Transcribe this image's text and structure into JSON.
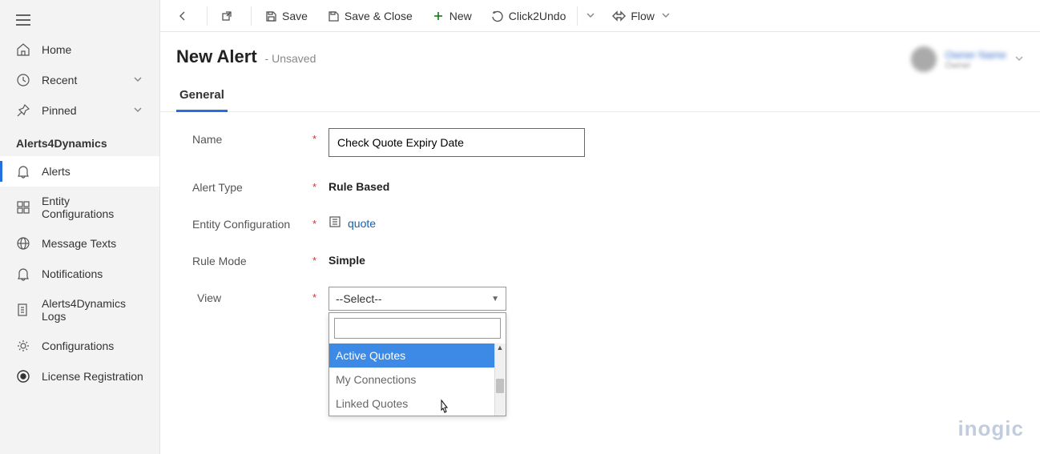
{
  "sidebar": {
    "section_title": "Alerts4Dynamics",
    "top_items": [
      {
        "label": "Home",
        "icon": "home"
      },
      {
        "label": "Recent",
        "icon": "clock",
        "chevron": true
      },
      {
        "label": "Pinned",
        "icon": "pin",
        "chevron": true
      }
    ],
    "items": [
      {
        "label": "Alerts",
        "icon": "bell",
        "active": true
      },
      {
        "label": "Entity Configurations",
        "icon": "grid"
      },
      {
        "label": "Message Texts",
        "icon": "globe"
      },
      {
        "label": "Notifications",
        "icon": "bell2"
      },
      {
        "label": "Alerts4Dynamics Logs",
        "icon": "log"
      },
      {
        "label": "Configurations",
        "icon": "gear"
      },
      {
        "label": "License Registration",
        "icon": "license"
      }
    ]
  },
  "cmdbar": {
    "back": "",
    "popout": "",
    "save": "Save",
    "save_close": "Save & Close",
    "new": "New",
    "undo": "Click2Undo",
    "flow": "Flow"
  },
  "header": {
    "title": "New Alert",
    "subtitle": "- Unsaved",
    "owner_name": "Owner Name",
    "owner_sub": "Owner"
  },
  "tabs": [
    {
      "label": "General",
      "active": true
    }
  ],
  "form": {
    "name_label": "Name",
    "name_value": "Check Quote Expiry Date",
    "alert_type_label": "Alert Type",
    "alert_type_value": "Rule Based",
    "entity_conf_label": "Entity Configuration",
    "entity_conf_value": "quote",
    "rule_mode_label": "Rule Mode",
    "rule_mode_value": "Simple",
    "view_label": "View",
    "view_placeholder": "--Select--",
    "view_options": [
      {
        "label": "Active Quotes",
        "highlighted": true
      },
      {
        "label": "My Connections"
      },
      {
        "label": "Linked Quotes"
      }
    ]
  },
  "brand": "inogic"
}
